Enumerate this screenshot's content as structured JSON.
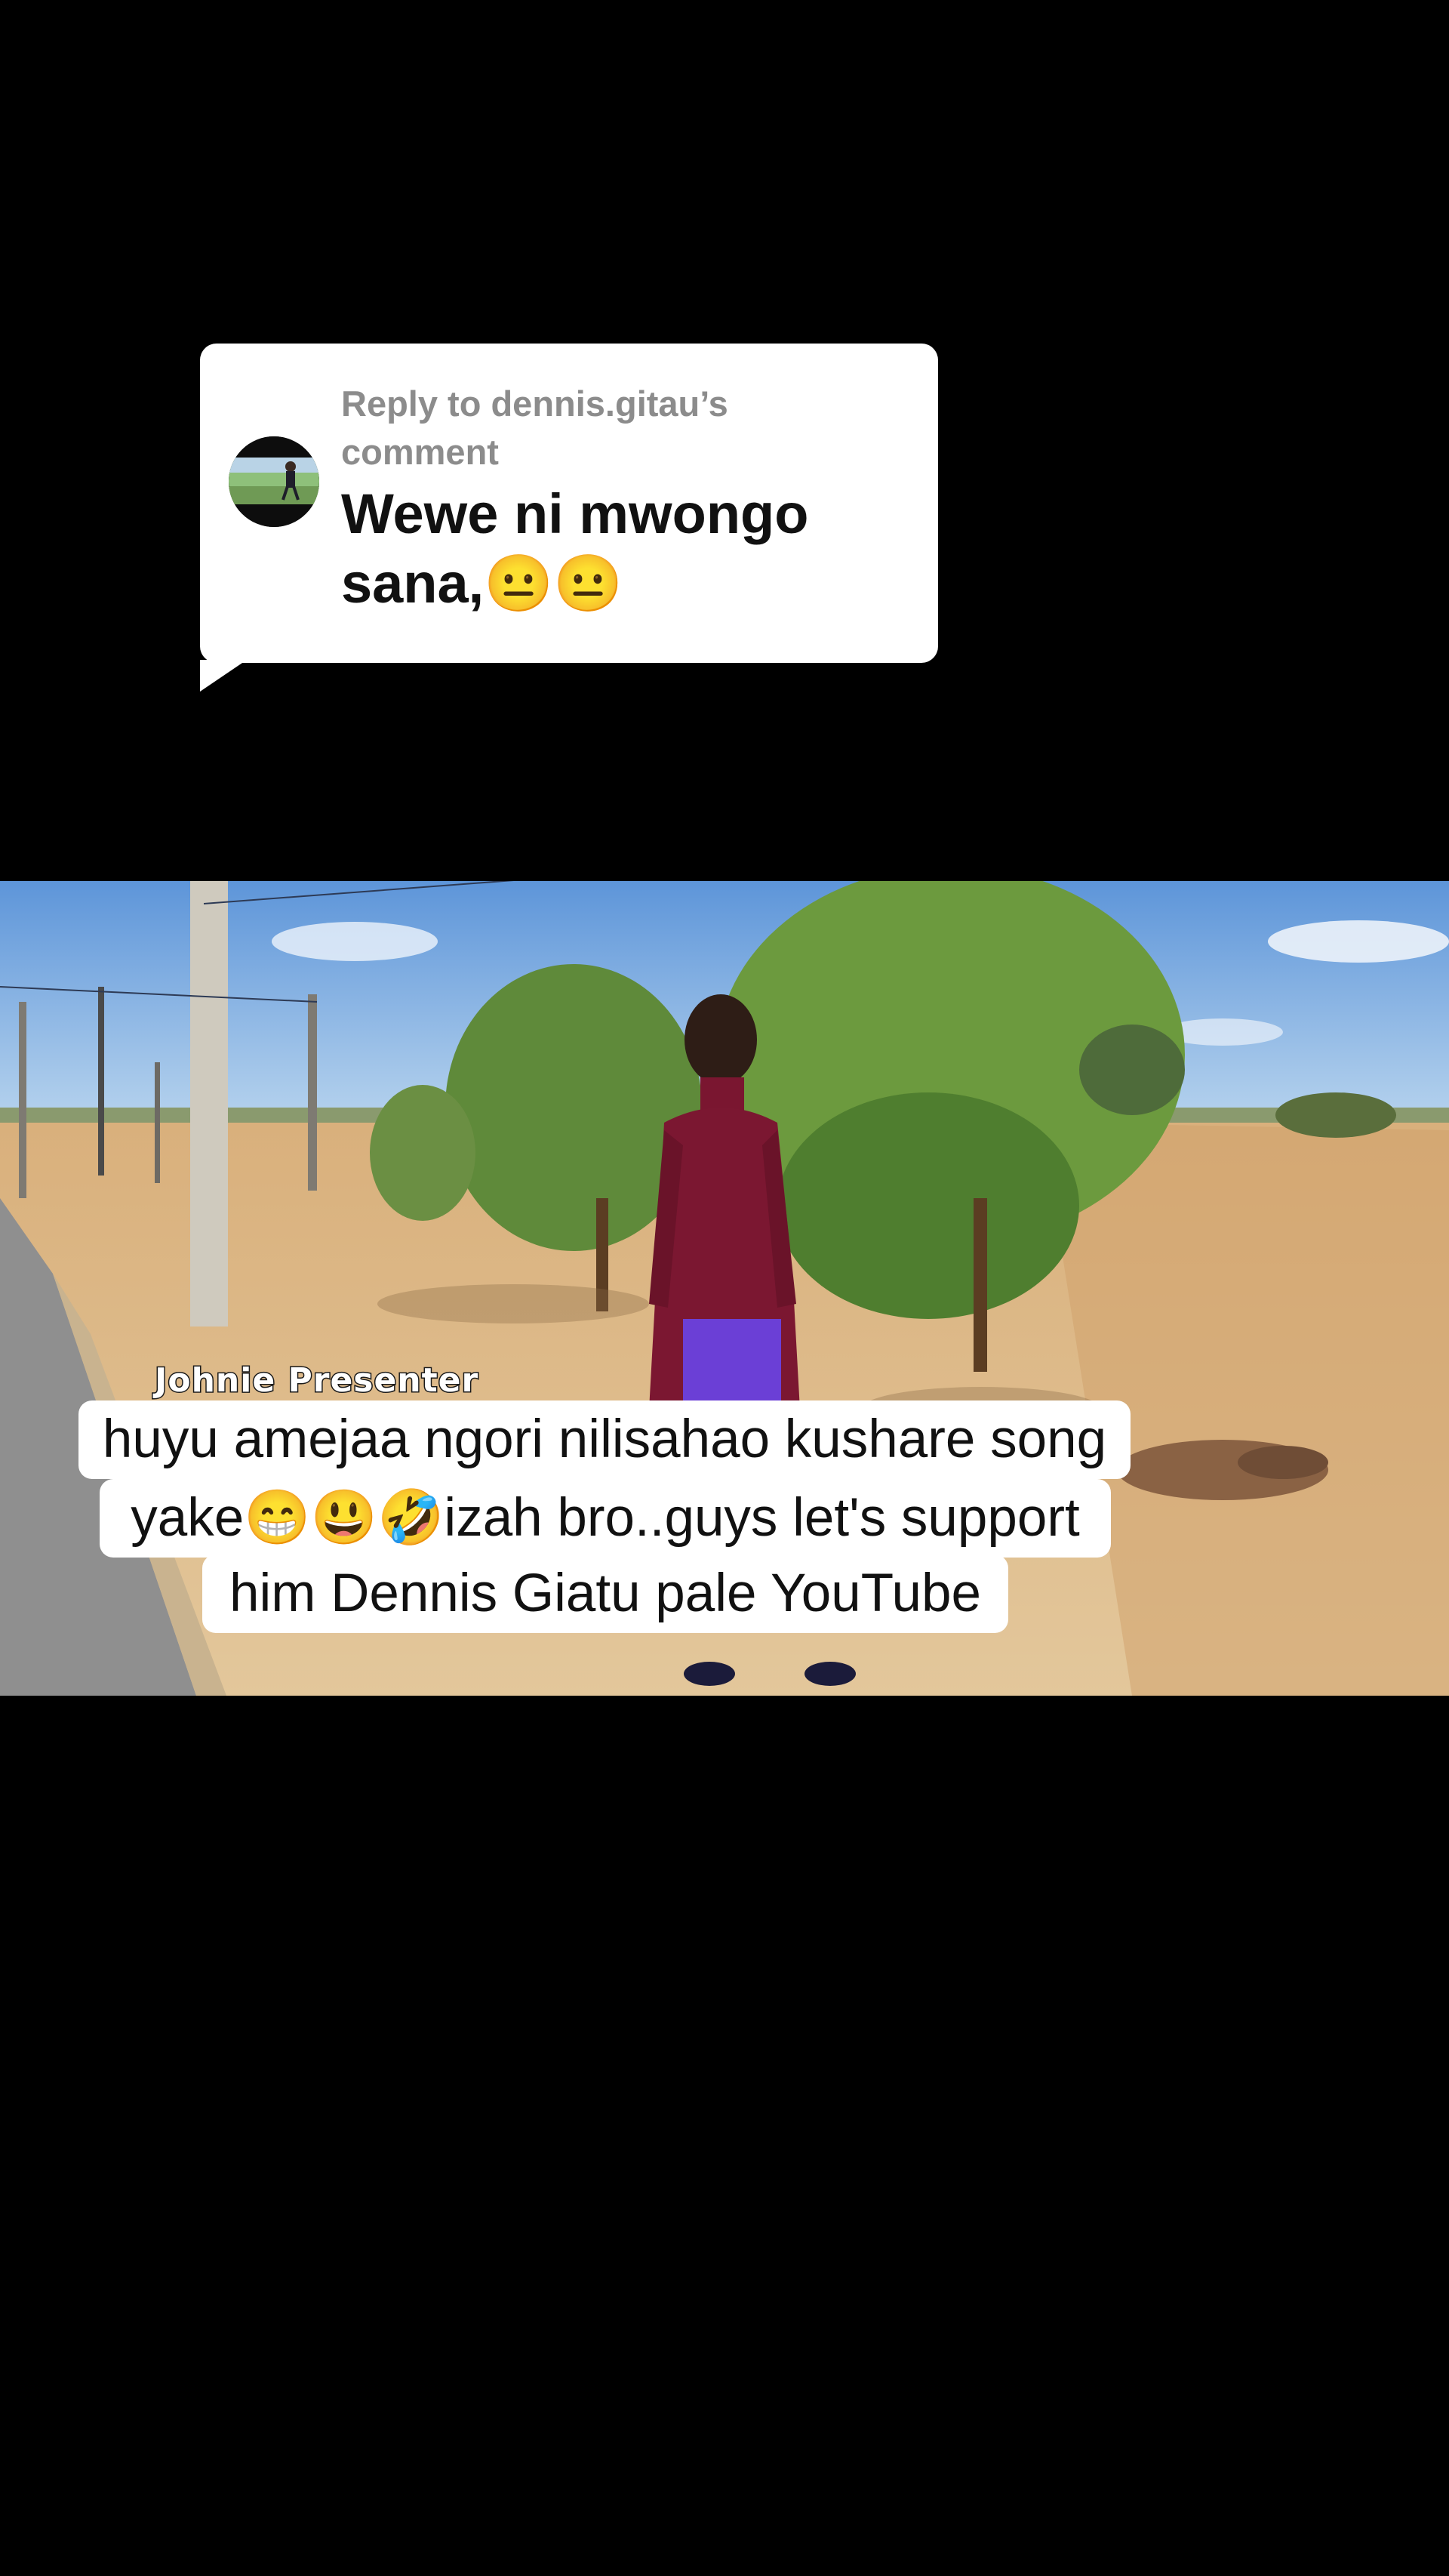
{
  "reply": {
    "label": "Reply to dennis.gitau’s comment",
    "comment_text": "Wewe ni mwongo sana,😐😐"
  },
  "video": {
    "watermark": "Johnie Presenter",
    "caption_lines": [
      "huyu amejaa ngori nilisahao kushare song",
      "yake😁😃🤣izah bro..guys let's support",
      "him Dennis Giatu pale YouTube"
    ]
  },
  "colors": {
    "background": "#000000",
    "bubble": "#ffffff",
    "reply_label": "#8c8c8c",
    "text": "#111111"
  }
}
